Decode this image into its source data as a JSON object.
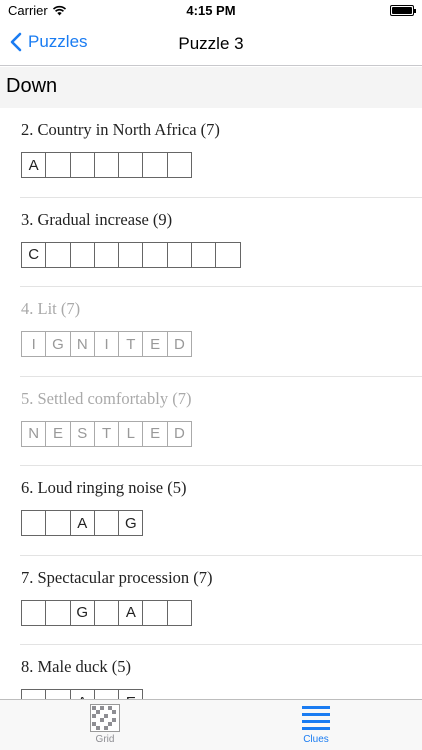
{
  "status": {
    "carrier": "Carrier",
    "time": "4:15 PM"
  },
  "nav": {
    "back_label": "Puzzles",
    "title": "Puzzle 3"
  },
  "section": {
    "title": "Down"
  },
  "clues": [
    {
      "text": "2. Country in North Africa (7)",
      "done": false,
      "cells": [
        "A",
        "",
        "",
        "",
        "",
        "",
        ""
      ]
    },
    {
      "text": "3. Gradual increase (9)",
      "done": false,
      "cells": [
        "C",
        "",
        "",
        "",
        "",
        "",
        "",
        "",
        ""
      ]
    },
    {
      "text": "4. Lit (7)",
      "done": true,
      "cells": [
        "I",
        "G",
        "N",
        "I",
        "T",
        "E",
        "D"
      ]
    },
    {
      "text": "5. Settled comfortably (7)",
      "done": true,
      "cells": [
        "N",
        "E",
        "S",
        "T",
        "L",
        "E",
        "D"
      ]
    },
    {
      "text": "6. Loud ringing noise (5)",
      "done": false,
      "cells": [
        "",
        "",
        "A",
        "",
        "G"
      ]
    },
    {
      "text": "7. Spectacular procession (7)",
      "done": false,
      "cells": [
        "",
        "",
        "G",
        "",
        "A",
        "",
        ""
      ]
    },
    {
      "text": "8. Male duck (5)",
      "done": false,
      "cells": [
        "",
        "",
        "A",
        "",
        "E"
      ]
    }
  ],
  "tabs": [
    {
      "label": "Grid",
      "icon": "grid-icon",
      "active": false
    },
    {
      "label": "Clues",
      "icon": "list-icon",
      "active": true
    }
  ],
  "colors": {
    "accent": "#1a7cf2",
    "inactive": "#8e8e93"
  }
}
